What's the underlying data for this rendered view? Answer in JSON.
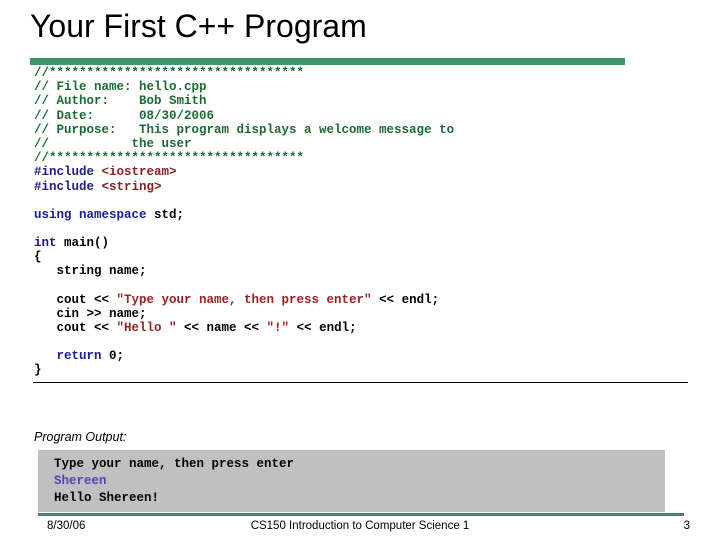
{
  "slide": {
    "title": "Your First C++ Program",
    "accent_color": "#3f9468",
    "footer_rule_color": "#4d7d70",
    "console_bg_color": "#c0c0c0"
  },
  "code": {
    "language": "cpp",
    "lines": [
      {
        "segments": [
          {
            "text": "//**********************************",
            "class": "cmt"
          }
        ]
      },
      {
        "segments": [
          {
            "text": "// File name: hello.cpp",
            "class": "cmt"
          }
        ]
      },
      {
        "segments": [
          {
            "text": "// Author:    Bob Smith",
            "class": "cmt"
          }
        ]
      },
      {
        "segments": [
          {
            "text": "// Date:      08/30/2006",
            "class": "cmt"
          }
        ]
      },
      {
        "segments": [
          {
            "text": "// Purpose:   This program displays a welcome message to",
            "class": "cmt"
          }
        ]
      },
      {
        "segments": [
          {
            "text": "//           the user",
            "class": "cmt"
          }
        ]
      },
      {
        "segments": [
          {
            "text": "//**********************************",
            "class": "cmt"
          }
        ]
      },
      {
        "segments": [
          {
            "text": "#include ",
            "class": "pre"
          },
          {
            "text": "<iostream>",
            "class": "hdr"
          }
        ]
      },
      {
        "segments": [
          {
            "text": "#include ",
            "class": "pre"
          },
          {
            "text": "<string>",
            "class": "hdr"
          }
        ]
      },
      {
        "segments": []
      },
      {
        "segments": [
          {
            "text": "using namespace ",
            "class": "kw"
          },
          {
            "text": "std;",
            "class": ""
          }
        ]
      },
      {
        "segments": []
      },
      {
        "segments": [
          {
            "text": "int ",
            "class": "kw"
          },
          {
            "text": "main()",
            "class": ""
          }
        ]
      },
      {
        "segments": [
          {
            "text": "{",
            "class": ""
          }
        ]
      },
      {
        "segments": [
          {
            "text": "   string name;",
            "class": ""
          }
        ]
      },
      {
        "segments": []
      },
      {
        "segments": [
          {
            "text": "   cout << ",
            "class": ""
          },
          {
            "text": "\"Type your name, then press enter\"",
            "class": "str"
          },
          {
            "text": " << endl;",
            "class": ""
          }
        ]
      },
      {
        "segments": [
          {
            "text": "   cin >> name;",
            "class": ""
          }
        ]
      },
      {
        "segments": [
          {
            "text": "   cout << ",
            "class": ""
          },
          {
            "text": "\"Hello \"",
            "class": "str"
          },
          {
            "text": " << name << ",
            "class": ""
          },
          {
            "text": "\"!\"",
            "class": "str"
          },
          {
            "text": " << endl;",
            "class": ""
          }
        ]
      },
      {
        "segments": []
      },
      {
        "segments": [
          {
            "text": "   ",
            "class": ""
          },
          {
            "text": "return ",
            "class": "kw"
          },
          {
            "text": "0;",
            "class": ""
          }
        ]
      },
      {
        "segments": [
          {
            "text": "}",
            "class": ""
          }
        ]
      }
    ]
  },
  "output": {
    "label": "Program Output:",
    "lines": [
      {
        "text": "Type your name, then press enter",
        "class": ""
      },
      {
        "text": "Shereen",
        "class": "usr"
      },
      {
        "text": "Hello Shereen!",
        "class": ""
      }
    ]
  },
  "footer": {
    "date": "8/30/06",
    "center": "CS150 Introduction to Computer Science 1",
    "page": "3"
  }
}
